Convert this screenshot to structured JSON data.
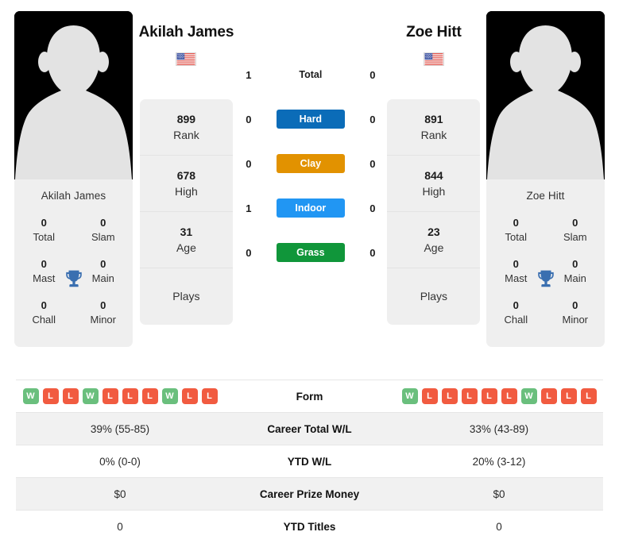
{
  "players": {
    "left": {
      "name": "Akilah James",
      "card_name": "Akilah James",
      "country": "United States",
      "flag_icon": "us-flag-icon",
      "titles": [
        {
          "num": "0",
          "label": "Total"
        },
        {
          "num": "0",
          "label": "Slam"
        },
        {
          "num": "0",
          "label": "Mast"
        },
        {
          "num": "0",
          "label": "Main"
        },
        {
          "num": "0",
          "label": "Chall"
        },
        {
          "num": "0",
          "label": "Minor"
        }
      ],
      "stats": [
        {
          "value": "899",
          "label": "Rank"
        },
        {
          "value": "678",
          "label": "High"
        },
        {
          "value": "31",
          "label": "Age"
        },
        {
          "value": "",
          "label": "Plays"
        }
      ],
      "surface_counts": {
        "total": "1",
        "hard": "0",
        "clay": "0",
        "indoor": "1",
        "grass": "0"
      },
      "form": [
        "W",
        "L",
        "L",
        "W",
        "L",
        "L",
        "L",
        "W",
        "L",
        "L"
      ],
      "career_total_wl": "39% (55-85)",
      "ytd_wl": "0% (0-0)",
      "career_prize_money": "$0",
      "ytd_titles": "0"
    },
    "right": {
      "name": "Zoe Hitt",
      "card_name": "Zoe Hitt",
      "country": "United States",
      "flag_icon": "us-flag-icon",
      "titles": [
        {
          "num": "0",
          "label": "Total"
        },
        {
          "num": "0",
          "label": "Slam"
        },
        {
          "num": "0",
          "label": "Mast"
        },
        {
          "num": "0",
          "label": "Main"
        },
        {
          "num": "0",
          "label": "Chall"
        },
        {
          "num": "0",
          "label": "Minor"
        }
      ],
      "stats": [
        {
          "value": "891",
          "label": "Rank"
        },
        {
          "value": "844",
          "label": "High"
        },
        {
          "value": "23",
          "label": "Age"
        },
        {
          "value": "",
          "label": "Plays"
        }
      ],
      "surface_counts": {
        "total": "0",
        "hard": "0",
        "clay": "0",
        "indoor": "0",
        "grass": "0"
      },
      "form": [
        "W",
        "L",
        "L",
        "L",
        "L",
        "L",
        "W",
        "L",
        "L",
        "L"
      ],
      "career_total_wl": "33% (43-89)",
      "ytd_wl": "20% (3-12)",
      "career_prize_money": "$0",
      "ytd_titles": "0"
    }
  },
  "surfaces": [
    {
      "key": "total",
      "label": "Total",
      "color": "transparent",
      "plain": true
    },
    {
      "key": "hard",
      "label": "Hard",
      "color": "#0b6cb8",
      "plain": false
    },
    {
      "key": "clay",
      "label": "Clay",
      "color": "#e29200",
      "plain": false
    },
    {
      "key": "indoor",
      "label": "Indoor",
      "color": "#2196f3",
      "plain": false
    },
    {
      "key": "grass",
      "label": "Grass",
      "color": "#10963a",
      "plain": false
    }
  ],
  "table": {
    "rows": [
      {
        "label": "Form",
        "key": "form",
        "type": "badges",
        "alt": false
      },
      {
        "label": "Career Total W/L",
        "key": "career_total_wl",
        "type": "text",
        "alt": true
      },
      {
        "label": "YTD W/L",
        "key": "ytd_wl",
        "type": "text",
        "alt": false
      },
      {
        "label": "Career Prize Money",
        "key": "career_prize_money",
        "type": "text",
        "alt": true
      },
      {
        "label": "YTD Titles",
        "key": "ytd_titles",
        "type": "text",
        "alt": false
      }
    ]
  },
  "colors": {
    "badge_win": "#6abf7d",
    "badge_loss": "#f15b40",
    "panel": "#efefef",
    "trophy": "#3a6fb0"
  }
}
